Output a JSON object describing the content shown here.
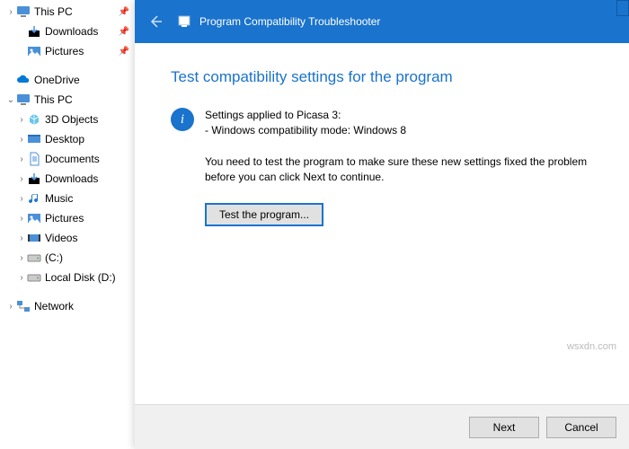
{
  "sidebar": {
    "items": [
      {
        "label": "This PC",
        "iconColor": "#4a90d9",
        "chev": ">",
        "pinned": true,
        "indent": false,
        "shape": "monitor"
      },
      {
        "label": "Downloads",
        "iconColor": "#4a90d9",
        "chev": "",
        "pinned": true,
        "indent": true,
        "shape": "down"
      },
      {
        "label": "Pictures",
        "iconColor": "#4a90d9",
        "chev": "",
        "pinned": true,
        "indent": true,
        "shape": "pic"
      },
      {
        "label": "OneDrive",
        "iconColor": "#0078d4",
        "chev": "",
        "pinned": false,
        "indent": false,
        "shape": "cloud"
      },
      {
        "label": "This PC",
        "iconColor": "#4a90d9",
        "chev": "v",
        "pinned": false,
        "indent": false,
        "shape": "monitor"
      },
      {
        "label": "3D Objects",
        "iconColor": "#67c7e8",
        "chev": ">",
        "pinned": false,
        "indent": true,
        "shape": "cube"
      },
      {
        "label": "Desktop",
        "iconColor": "#4a90d9",
        "chev": ">",
        "pinned": false,
        "indent": true,
        "shape": "desk"
      },
      {
        "label": "Documents",
        "iconColor": "#4a90d9",
        "chev": ">",
        "pinned": false,
        "indent": true,
        "shape": "doc"
      },
      {
        "label": "Downloads",
        "iconColor": "#4a90d9",
        "chev": ">",
        "pinned": false,
        "indent": true,
        "shape": "down"
      },
      {
        "label": "Music",
        "iconColor": "#2176c7",
        "chev": ">",
        "pinned": false,
        "indent": true,
        "shape": "music"
      },
      {
        "label": "Pictures",
        "iconColor": "#4a90d9",
        "chev": ">",
        "pinned": false,
        "indent": true,
        "shape": "pic"
      },
      {
        "label": "Videos",
        "iconColor": "#4a90d9",
        "chev": ">",
        "pinned": false,
        "indent": true,
        "shape": "vid"
      },
      {
        "label": "(C:)",
        "iconColor": "#888",
        "chev": ">",
        "pinned": false,
        "indent": true,
        "shape": "disk"
      },
      {
        "label": "Local Disk (D:)",
        "iconColor": "#888",
        "chev": ">",
        "pinned": false,
        "indent": true,
        "shape": "disk"
      },
      {
        "label": "Network",
        "iconColor": "#4a90d9",
        "chev": ">",
        "pinned": false,
        "indent": false,
        "shape": "net"
      }
    ]
  },
  "dialog": {
    "title": "Program Compatibility Troubleshooter",
    "heading": "Test compatibility settings for the program",
    "info_line1": "Settings applied to Picasa 3:",
    "info_line2": "- Windows compatibility mode: Windows 8",
    "instruction": "You need to test the program to make sure these new settings fixed the problem before you can click Next to continue.",
    "test_button": "Test the program...",
    "next": "Next",
    "cancel": "Cancel"
  },
  "watermark": "wsxdn.com"
}
